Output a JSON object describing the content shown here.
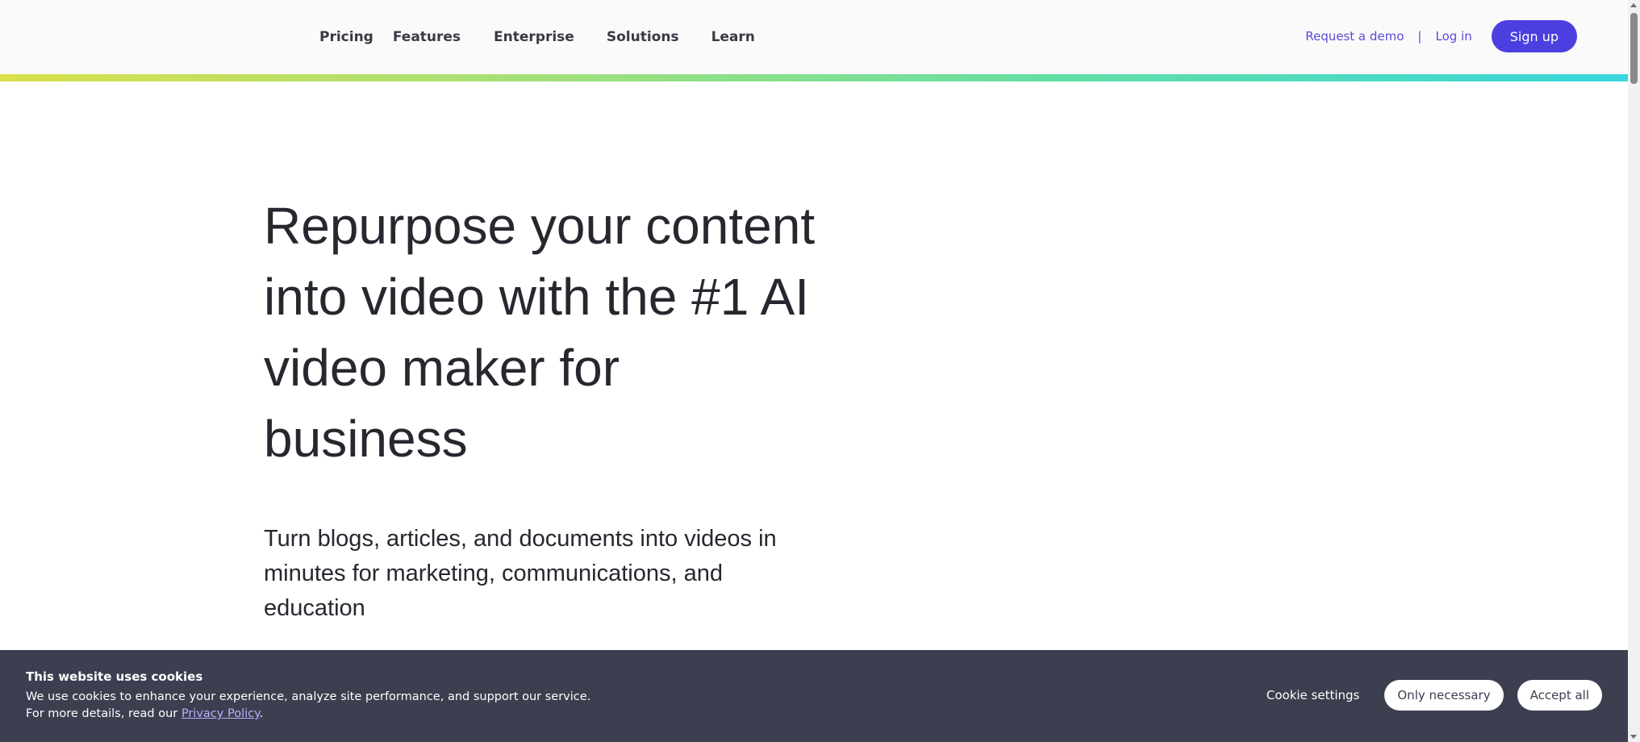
{
  "nav": {
    "items": [
      "Pricing",
      "Features",
      "Enterprise",
      "Solutions",
      "Learn"
    ]
  },
  "header_actions": {
    "request_demo": "Request a demo",
    "separator": "|",
    "login": "Log in",
    "signup": "Sign up"
  },
  "hero": {
    "title": "Repurpose your content into video with the #1 AI video maker for business",
    "subtitle": "Turn blogs, articles, and documents into videos in minutes for marketing, communications, and education"
  },
  "cookie_banner": {
    "title": "This website uses cookies",
    "text": "We use cookies to enhance your experience, analyze site performance, and support our service. For more details, read our ",
    "privacy_link": "Privacy Policy",
    "text_end": ".",
    "settings": "Cookie settings",
    "only_necessary": "Only necessary",
    "accept_all": "Accept all"
  },
  "colors": {
    "accent": "#4b3fe0",
    "link": "#5a4bd8",
    "banner_bg": "#3b3f4f",
    "text": "#27272f"
  }
}
